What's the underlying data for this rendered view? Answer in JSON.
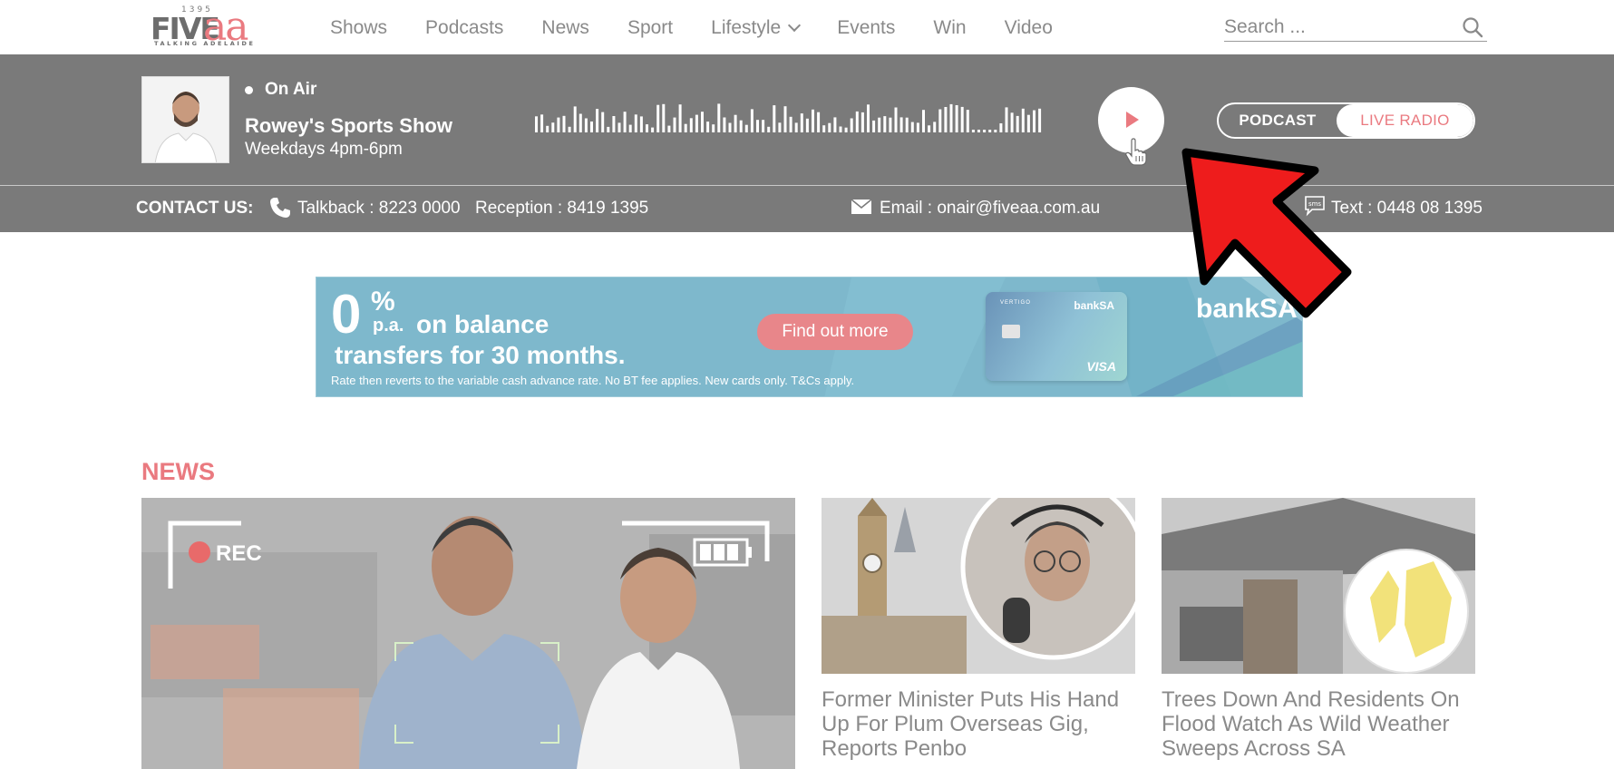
{
  "logo": {
    "number": "1395",
    "five": "FIVE",
    "aa": "aa",
    "tagline": "TALKING ADELAIDE"
  },
  "nav": {
    "items": [
      "Shows",
      "Podcasts",
      "News",
      "Sport",
      "Lifestyle",
      "Events",
      "Win",
      "Video"
    ],
    "search_placeholder": "Search ..."
  },
  "player": {
    "status": "On Air",
    "show_name": "Rowey's Sports Show",
    "show_time": "Weekdays 4pm-6pm",
    "toggle_podcast": "PODCAST",
    "toggle_live": "LIVE RADIO"
  },
  "contact": {
    "label": "CONTACT US:",
    "talkback": "Talkback : 8223 0000",
    "reception": "Reception : 8419 1395",
    "email": "Email : onair@fiveaa.com.au",
    "text": "Text : 0448 08 1395",
    "sms_icon_text": "sms"
  },
  "ad": {
    "percent": "0",
    "percent_sign": "%",
    "pa": "p.a.",
    "headline_1": "on balance",
    "headline_2": "transfers for 30 months.",
    "fine_print": "Rate then reverts to the variable cash advance rate. No BT fee applies. New cards only. T&Cs apply.",
    "cta": "Find out more",
    "card_small": "VERTIGO",
    "card_bank": "bankSA",
    "card_visa": "VISA",
    "brand": "bankSA"
  },
  "news": {
    "heading": "NEWS",
    "hero_rec": "REC",
    "articles": [
      {
        "title": "Former Minister Puts His Hand Up For Plum Overseas Gig, Reports Penbo"
      },
      {
        "title": "Trees Down And Residents On Flood Watch As Wild Weather Sweeps Across SA"
      }
    ]
  },
  "colors": {
    "accent": "#ea7a80",
    "bar": "#7a7a7a",
    "text_grey": "#8a8a8a"
  }
}
